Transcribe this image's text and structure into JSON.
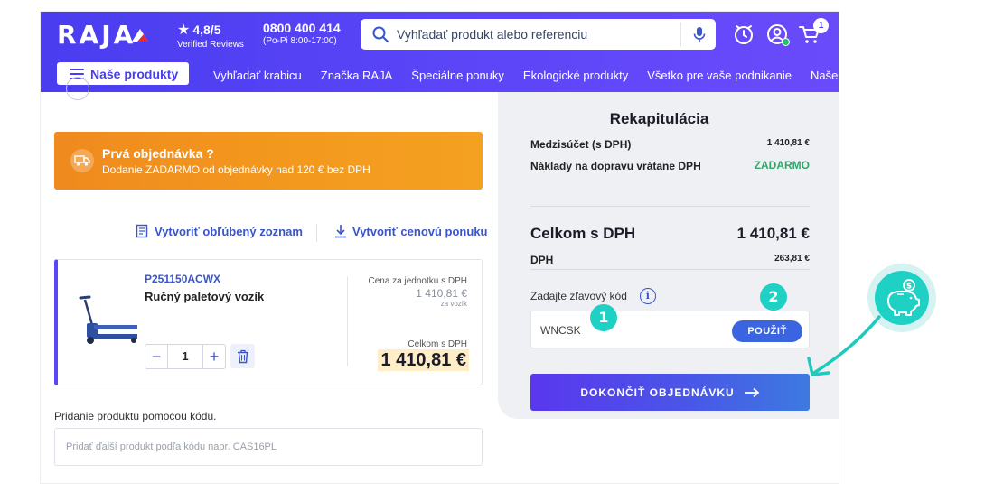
{
  "header": {
    "logo": "RAJA",
    "rating": "4,8/5",
    "rating_sub": "Verified Reviews",
    "phone": "0800 400 414",
    "phone_hours": "(Po-Pi 8:00-17:00)",
    "search_placeholder": "Vyhľadať produkt alebo referenciu",
    "cart_count": "1"
  },
  "nav": {
    "menu_button": "Naše produkty",
    "links": [
      "Vyhľadať krabicu",
      "Značka RAJA",
      "Špeciálne ponuky",
      "Ekologické produkty",
      "Všetko pre vaše podnikanie",
      "Naše"
    ]
  },
  "banner": {
    "title": "Prvá objednávka ?",
    "subtitle": "Dodanie ZADARMO od objednávky nad 120 € bez DPH"
  },
  "actions": {
    "favourite": "Vytvoriť obľúbený zoznam",
    "quote": "Vytvoriť cenovú ponuku"
  },
  "product": {
    "ref": "P251150ACWX",
    "name": "Ručný paletový vozík",
    "quantity": "1",
    "unit_price_label": "Cena za jednotku s DPH",
    "unit_price": "1 410,81 €",
    "unit_per": "za vozík",
    "total_label": "Celkom s DPH",
    "total_price": "1 410,81 €"
  },
  "add_product": {
    "label": "Pridanie produktu pomocou kódu.",
    "placeholder": "Pridať ďalší produkt podľa kódu napr. CAS16PL"
  },
  "summary": {
    "title": "Rekapitulácia",
    "subtotal_label": "Medzisúčet (s DPH)",
    "subtotal": "1 410,81 €",
    "shipping_label": "Náklady na dopravu vrátane DPH",
    "shipping": "ZADARMO",
    "total_label": "Celkom s DPH",
    "total": "1 410,81 €",
    "vat_label": "DPH",
    "vat": "263,81 €",
    "promo_label": "Zadajte zľavový kód",
    "promo_value": "WNCSK",
    "apply": "POUŽIŤ",
    "checkout": "DOKONČIŤ OBJEDNÁVKU"
  },
  "annotations": {
    "step1": "1",
    "step2": "2"
  },
  "colors": {
    "brand": "#5a45f7",
    "banner": "#f39a1e",
    "accent_teal": "#1fd0c4",
    "link": "#3a55c8",
    "free": "#33a36a"
  }
}
